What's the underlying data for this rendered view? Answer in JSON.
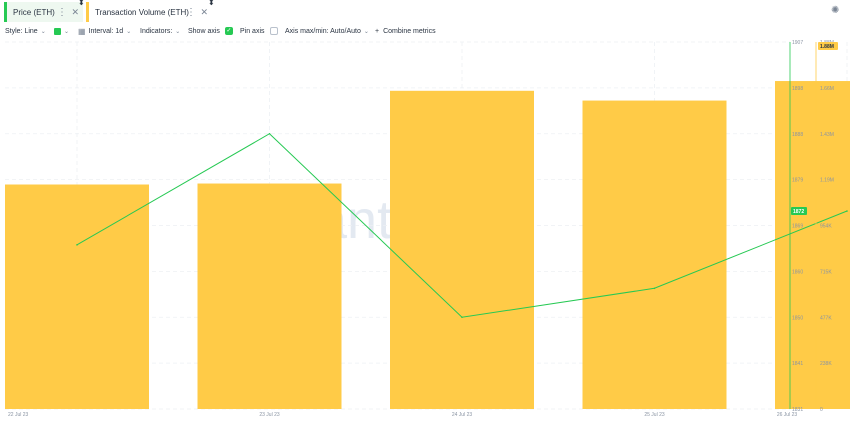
{
  "tabs": [
    {
      "label": "Price (ETH)",
      "color": "#26c953",
      "active": true
    },
    {
      "label": "Transaction Volume (ETH)",
      "color": "#ffcb47",
      "active": false
    }
  ],
  "toolbar": {
    "style_label": "Style: Line",
    "interval_label": "Interval: 1d",
    "indicators_label": "Indicators:",
    "show_axis_label": "Show axis",
    "pin_axis_label": "Pin axis",
    "axis_minmax_label": "Axis max/min: Auto/Auto",
    "combine_label": "Combine metrics",
    "combine_plus": "+",
    "show_axis_checked": true,
    "pin_axis_checked": false
  },
  "watermark": "santiment",
  "chart_data": {
    "type": "bar",
    "x": [
      "22 Jul 23",
      "23 Jul 23",
      "24 Jul 23",
      "25 Jul 23",
      "26 Jul 23"
    ],
    "series": [
      {
        "name": "Transaction Volume (ETH)",
        "type": "bar",
        "color": "#ffcb47",
        "values": [
          1150000,
          1155000,
          1630000,
          1580000,
          1680000
        ],
        "axis": "right"
      },
      {
        "name": "Price (ETH)",
        "type": "line",
        "color": "#26c953",
        "values": [
          1865,
          1888,
          1850,
          1856,
          1872
        ],
        "axis": "left"
      }
    ],
    "price_axis": {
      "ticks": [
        "1907",
        "1898",
        "1888",
        "1879",
        "1869",
        "1860",
        "1850",
        "1841",
        "1831"
      ],
      "range": [
        1831,
        1907
      ]
    },
    "volume_axis": {
      "ticks": [
        "1.88M",
        "1.66M",
        "1.43M",
        "1.19M",
        "954K",
        "715K",
        "477K",
        "238K",
        "0"
      ],
      "range": [
        0,
        1880000
      ]
    },
    "last_price_badge": "1872",
    "last_volume_badge": "1.88M",
    "grid": true,
    "legend": "top-left tabs"
  }
}
